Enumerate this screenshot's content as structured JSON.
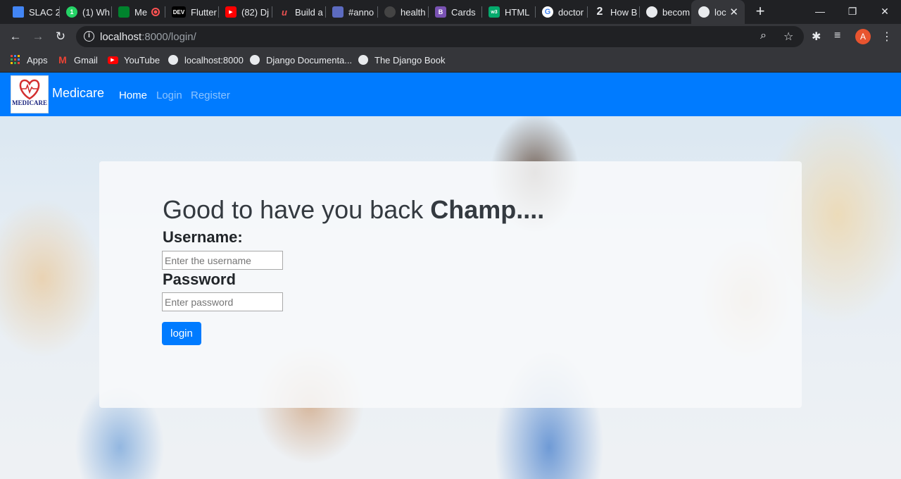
{
  "browser": {
    "tabs": [
      {
        "title": "SLAC 2",
        "icon": "docs-icon",
        "color": "#4285f4"
      },
      {
        "title": "(1) Wh",
        "icon": "whatsapp-icon",
        "color": "#25d366"
      },
      {
        "title": "Me",
        "icon": "meet-icon",
        "color": "#00832d"
      },
      {
        "title": "Flutter",
        "icon": "dev-icon",
        "color": "#000000"
      },
      {
        "title": "(82) Dj",
        "icon": "youtube-icon",
        "color": "#ff0000"
      },
      {
        "title": "Build a",
        "icon": "udemy-icon",
        "color": "#a435f0"
      },
      {
        "title": "#anno",
        "icon": "app-icon",
        "color": "#5c6bc0"
      },
      {
        "title": "health",
        "icon": "github-icon",
        "color": "#24292e"
      },
      {
        "title": "Cards",
        "icon": "bootstrap-icon",
        "color": "#7952b3"
      },
      {
        "title": "HTML",
        "icon": "w3schools-icon",
        "color": "#04aa6d"
      },
      {
        "title": "doctor",
        "icon": "google-icon",
        "color": "#ffffff"
      },
      {
        "title": "How B",
        "icon": "number-2-icon",
        "color": "#1a73e8"
      },
      {
        "title": "becom",
        "icon": "globe-icon",
        "color": "#e8eaed"
      },
      {
        "title": "loc",
        "icon": "globe-icon",
        "color": "#e8eaed",
        "active": true
      }
    ],
    "new_tab": "+",
    "window_controls": {
      "minimize": "—",
      "restore": "❐",
      "close": "✕"
    },
    "url_host": "localhost",
    "url_rest": ":8000/login/",
    "avatar_letter": "A",
    "bookmarks": [
      {
        "label": "Apps",
        "icon": "apps-grid-icon"
      },
      {
        "label": "Gmail",
        "icon": "gmail-icon"
      },
      {
        "label": "YouTube",
        "icon": "youtube-icon"
      },
      {
        "label": "localhost:8000",
        "icon": "globe-icon"
      },
      {
        "label": "Django Documenta...",
        "icon": "globe-icon"
      },
      {
        "label": "The Django Book",
        "icon": "globe-icon"
      }
    ]
  },
  "site": {
    "logo_text": "MEDICARE",
    "brand": "Medicare",
    "nav": {
      "home": "Home",
      "login": "Login",
      "register": "Register"
    },
    "accent": "#007bff"
  },
  "login": {
    "heading_prefix": "Good to have you back ",
    "heading_bold": "Champ....",
    "username_label": "Username:",
    "username_placeholder": "Enter the username",
    "password_label": "Password",
    "password_placeholder": "Enter password",
    "submit_label": "login"
  }
}
